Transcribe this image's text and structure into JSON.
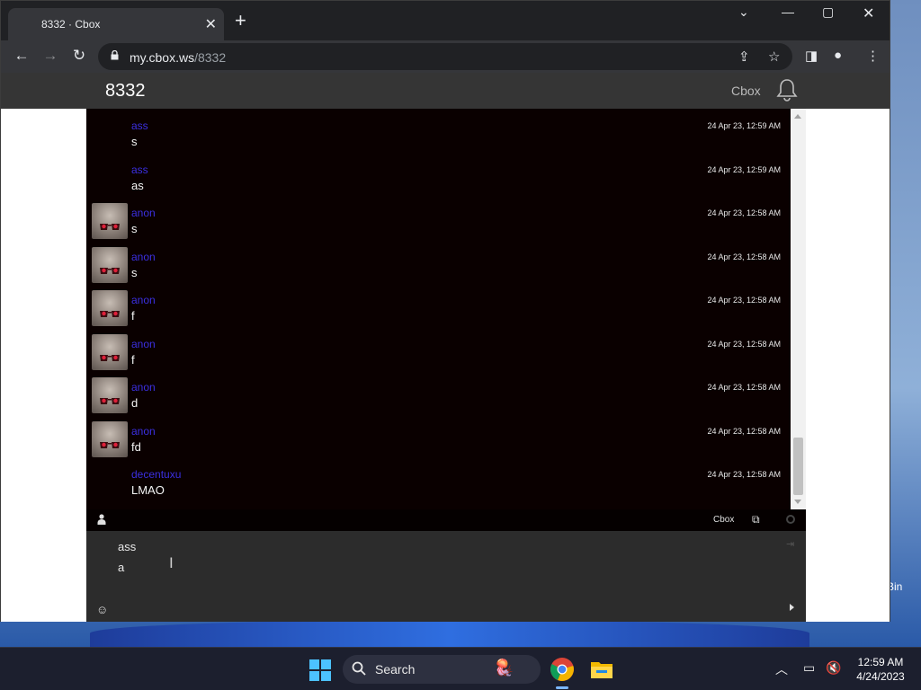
{
  "browser": {
    "tab_title": "8332 · Cbox",
    "url_host": "my.cbox.ws",
    "url_path": "/8332"
  },
  "site": {
    "title": "8332",
    "brand": "Cbox"
  },
  "messages": [
    {
      "user": "ass",
      "text": "s",
      "time": "24 Apr 23, 12:59 AM",
      "avatar": false
    },
    {
      "user": "ass",
      "text": "as",
      "time": "24 Apr 23, 12:59 AM",
      "avatar": false
    },
    {
      "user": "anon",
      "text": "s",
      "time": "24 Apr 23, 12:58 AM",
      "avatar": true
    },
    {
      "user": "anon",
      "text": "s",
      "time": "24 Apr 23, 12:58 AM",
      "avatar": true
    },
    {
      "user": "anon",
      "text": "f",
      "time": "24 Apr 23, 12:58 AM",
      "avatar": true
    },
    {
      "user": "anon",
      "text": "f",
      "time": "24 Apr 23, 12:58 AM",
      "avatar": true
    },
    {
      "user": "anon",
      "text": "d",
      "time": "24 Apr 23, 12:58 AM",
      "avatar": true
    },
    {
      "user": "anon",
      "text": "fd",
      "time": "24 Apr 23, 12:58 AM",
      "avatar": true
    },
    {
      "user": "decentuxu",
      "text": "LMAO",
      "time": "24 Apr 23, 12:58 AM",
      "avatar": false
    }
  ],
  "chat_bar": {
    "brand": "Cbox"
  },
  "input": {
    "name": "ass",
    "message": "a"
  },
  "desktop": {
    "icon_label": "Bin"
  },
  "taskbar": {
    "search_label": "Search",
    "time": "12:59 AM",
    "date": "4/24/2023"
  }
}
